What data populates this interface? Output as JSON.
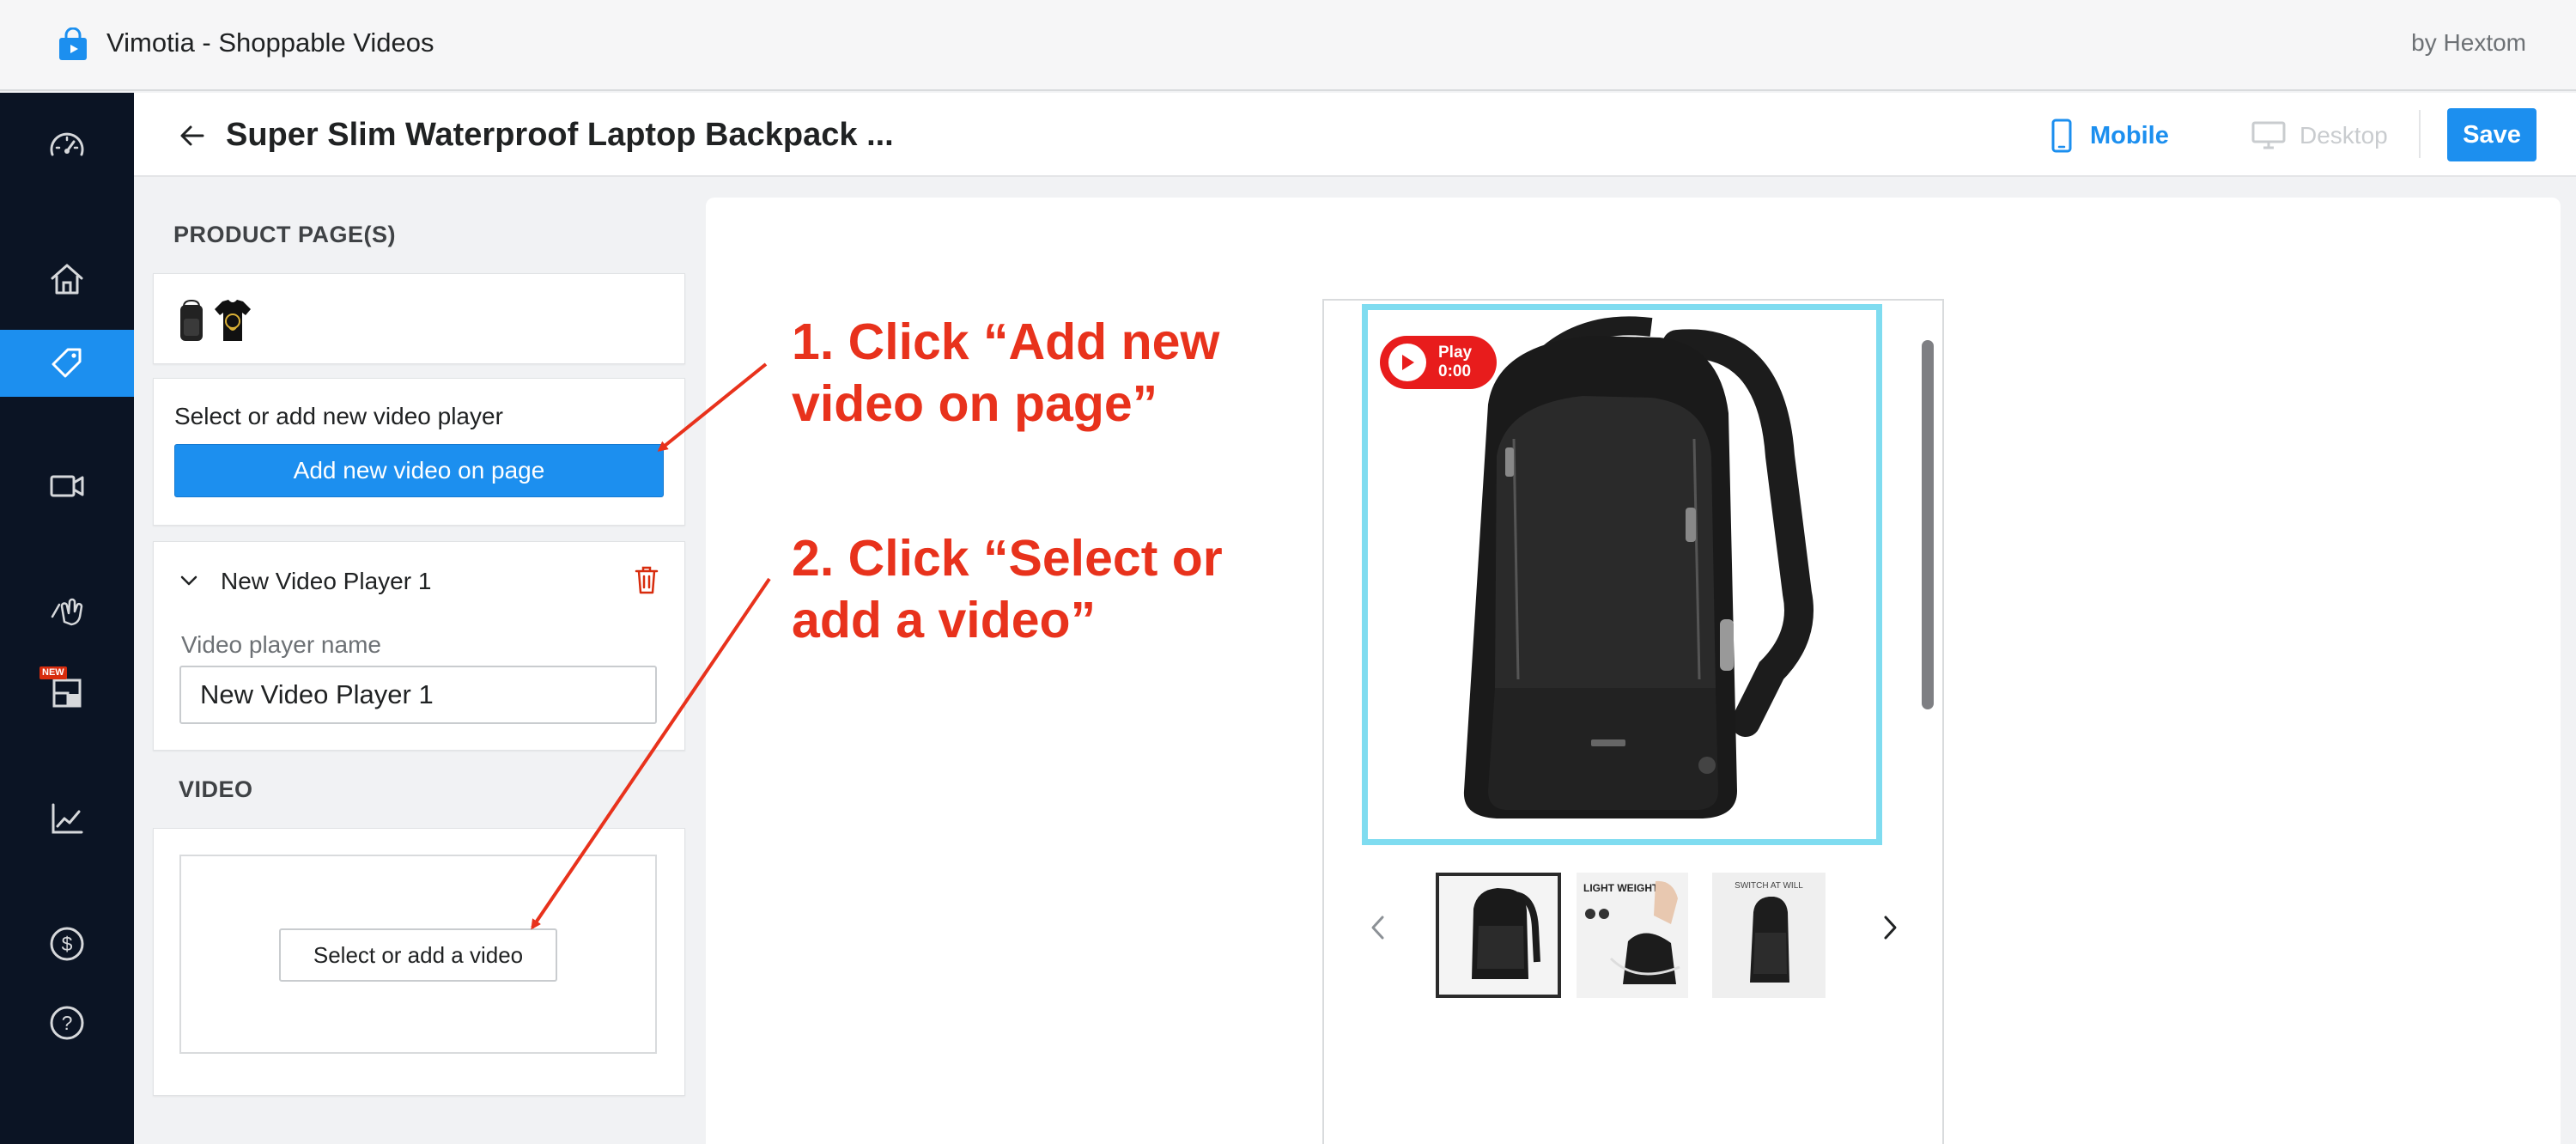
{
  "app": {
    "title": "Vimotia - Shoppable Videos",
    "vendor": "by Hextom",
    "icon": "shopping-bag-play-icon"
  },
  "sidebar": {
    "items": [
      {
        "icon": "dashboard-gauge-icon",
        "active": false
      },
      {
        "icon": "home-icon",
        "active": false
      },
      {
        "icon": "tag-icon",
        "active": true
      },
      {
        "icon": "video-camera-icon",
        "active": false
      },
      {
        "icon": "hand-tap-icon",
        "active": false
      },
      {
        "icon": "new-widget-icon",
        "active": false,
        "badge": "NEW"
      },
      {
        "icon": "analytics-chart-icon",
        "active": false
      },
      {
        "icon": "dollar-icon",
        "active": false
      },
      {
        "icon": "help-icon",
        "active": false
      }
    ]
  },
  "header": {
    "title": "Super Slim Waterproof Laptop Backpack ...",
    "mobile_label": "Mobile",
    "desktop_label": "Desktop",
    "save_label": "Save",
    "active_view": "mobile"
  },
  "panel": {
    "product_pages_heading": "PRODUCT PAGE(S)",
    "select_label": "Select or add new video player",
    "add_button": "Add new video on page",
    "player": {
      "title": "New Video Player 1",
      "name_label": "Video player name",
      "name_value": "New Video Player 1"
    },
    "video_heading": "VIDEO",
    "select_video_button": "Select or add a video"
  },
  "preview": {
    "play_label": "Play",
    "play_time": "0:00",
    "thumb_texts": [
      "LIGHT WEIGHT",
      "SWITCH AT WILL"
    ]
  },
  "annotations": {
    "step1_line1": "1. Click “Add new",
    "step1_line2": "video on page”",
    "step2_line1": "2. Click “Select or",
    "step2_line2": "add a video”"
  },
  "colors": {
    "accent": "#1c8fef",
    "sidebar_bg": "#0b1424",
    "annotation": "#e8321c",
    "delete": "#d82c0d",
    "image_border": "#7fdcf0",
    "play_badge": "#e81c1c"
  }
}
